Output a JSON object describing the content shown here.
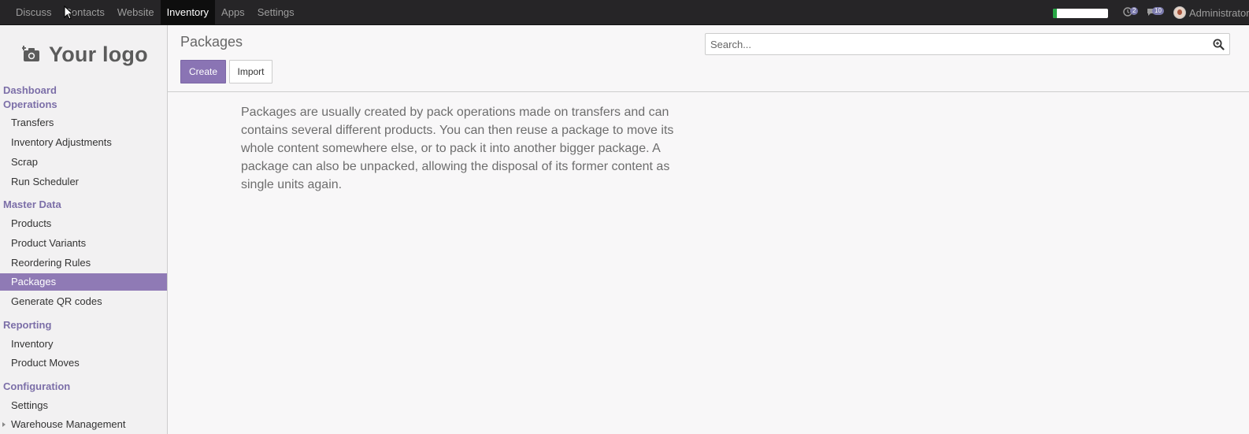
{
  "topbar": {
    "nav": [
      {
        "label": "Discuss"
      },
      {
        "label": "Contacts"
      },
      {
        "label": "Website"
      },
      {
        "label": "Inventory",
        "active": true
      },
      {
        "label": "Apps"
      },
      {
        "label": "Settings"
      }
    ],
    "progress_fraction": 0.07,
    "activity_count": "2",
    "messages_count": "10",
    "user_name": "Administrator"
  },
  "sidebar": {
    "logo_text": "Your logo",
    "sections": [
      {
        "label": "Dashboard"
      },
      {
        "label": "Operations",
        "items": [
          "Transfers",
          "Inventory Adjustments",
          "Scrap",
          "Run Scheduler"
        ]
      },
      {
        "label": "Master Data",
        "items": [
          "Products",
          "Product Variants",
          "Reordering Rules",
          "Packages",
          "Generate QR codes"
        ]
      },
      {
        "label": "Reporting",
        "items": [
          "Inventory",
          "Product Moves"
        ]
      },
      {
        "label": "Configuration",
        "items": [
          "Settings",
          "Warehouse Management"
        ]
      }
    ],
    "active_item": "Packages"
  },
  "control_panel": {
    "title": "Packages",
    "create_label": "Create",
    "import_label": "Import",
    "search_placeholder": "Search..."
  },
  "content": {
    "help_text": "Packages are usually created by pack operations made on transfers and can contains several different products. You can then reuse a package to move its whole content somewhere else, or to pack it into another bigger package. A package can also be unpacked, allowing the disposal of its former content as single units again."
  },
  "colors": {
    "brand": "#7c6fa8",
    "active_item_bg": "#8f7ab5",
    "topbar_bg": "#262527"
  }
}
